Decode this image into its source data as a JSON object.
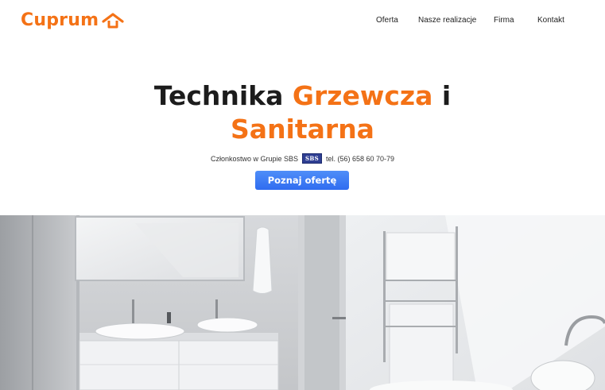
{
  "header": {
    "logo_text": "Cuprum",
    "nav": [
      "Oferta",
      "Nasze realizacje",
      "Firma",
      "Kontakt"
    ]
  },
  "hero": {
    "title_part1": "Technika ",
    "title_accent1": "Grzewcza",
    "title_part2": " i",
    "title_accent2": "Sanitarna",
    "membership_text": "Członkostwo w Grupie SBS",
    "badge_text": "SBS",
    "phone_text": "tel. (56) 658 60 70-79",
    "cta_label": "Poznaj ofertę"
  },
  "colors": {
    "brand_orange": "#f47216",
    "cta_blue": "#3a78f2",
    "badge_blue": "#2f3f93"
  },
  "icons": {
    "logo": "house-roof-icon"
  },
  "image": {
    "subject": "bathroom-photo"
  }
}
